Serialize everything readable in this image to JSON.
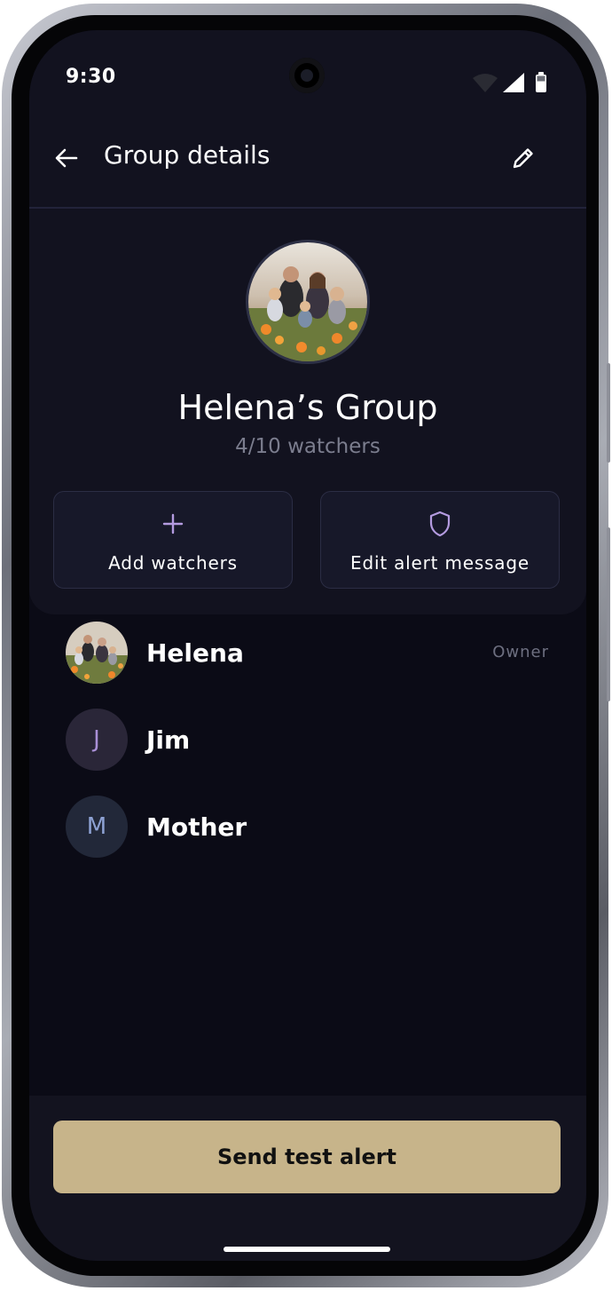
{
  "status_bar": {
    "time": "9:30"
  },
  "header": {
    "title": "Group details"
  },
  "group": {
    "name": "Helena’s Group",
    "watchers": "4/10 watchers"
  },
  "actions": {
    "add_watchers": "Add watchers",
    "edit_alert_message": "Edit alert message"
  },
  "members": [
    {
      "name": "Helena",
      "role": "Owner",
      "avatar": "photo"
    },
    {
      "name": "Jim",
      "initial": "J",
      "avatar_color": "#2a2638",
      "initial_color": "#a98fd6"
    },
    {
      "name": "Mother",
      "initial": "M",
      "avatar_color": "#222839",
      "initial_color": "#8ea2d4"
    }
  ],
  "footer": {
    "send_test_alert": "Send test alert"
  },
  "colors": {
    "accent": "#c7b48a",
    "icon_purple": "#b49be0",
    "background": "#0b0b16",
    "panel": "#12121f"
  }
}
